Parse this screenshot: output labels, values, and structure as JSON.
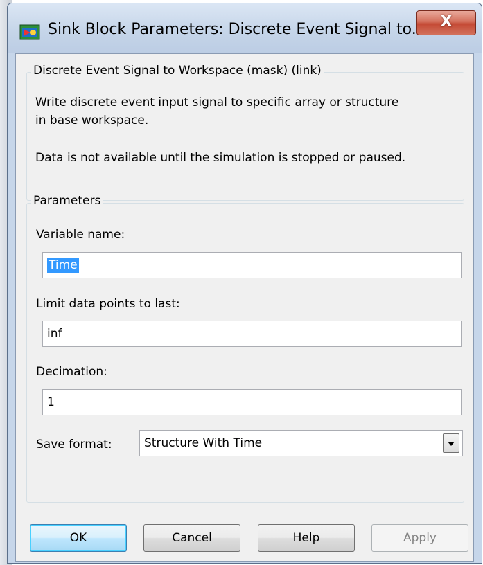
{
  "window": {
    "title": "Sink Block Parameters: Discrete Event Signal to...",
    "close_glyph": "X"
  },
  "description": {
    "legend": "Discrete Event Signal to Workspace (mask) (link)",
    "line1": "Write discrete event input signal to specific array or structure",
    "line2": "in base workspace.",
    "line3": "Data is not available until the simulation is stopped or paused."
  },
  "parameters": {
    "legend": "Parameters",
    "variable_name_label": "Variable name:",
    "variable_name_value": "Time",
    "limit_label": "Limit data points to last:",
    "limit_value": "inf",
    "decimation_label": "Decimation:",
    "decimation_value": "1",
    "save_format_label": "Save format:",
    "save_format_value": "Structure With Time"
  },
  "buttons": {
    "ok": "OK",
    "cancel": "Cancel",
    "help": "Help",
    "apply": "Apply"
  },
  "icons": {
    "title": "simulink-block-icon",
    "close": "close-icon",
    "dropdown": "chevron-down-icon"
  }
}
